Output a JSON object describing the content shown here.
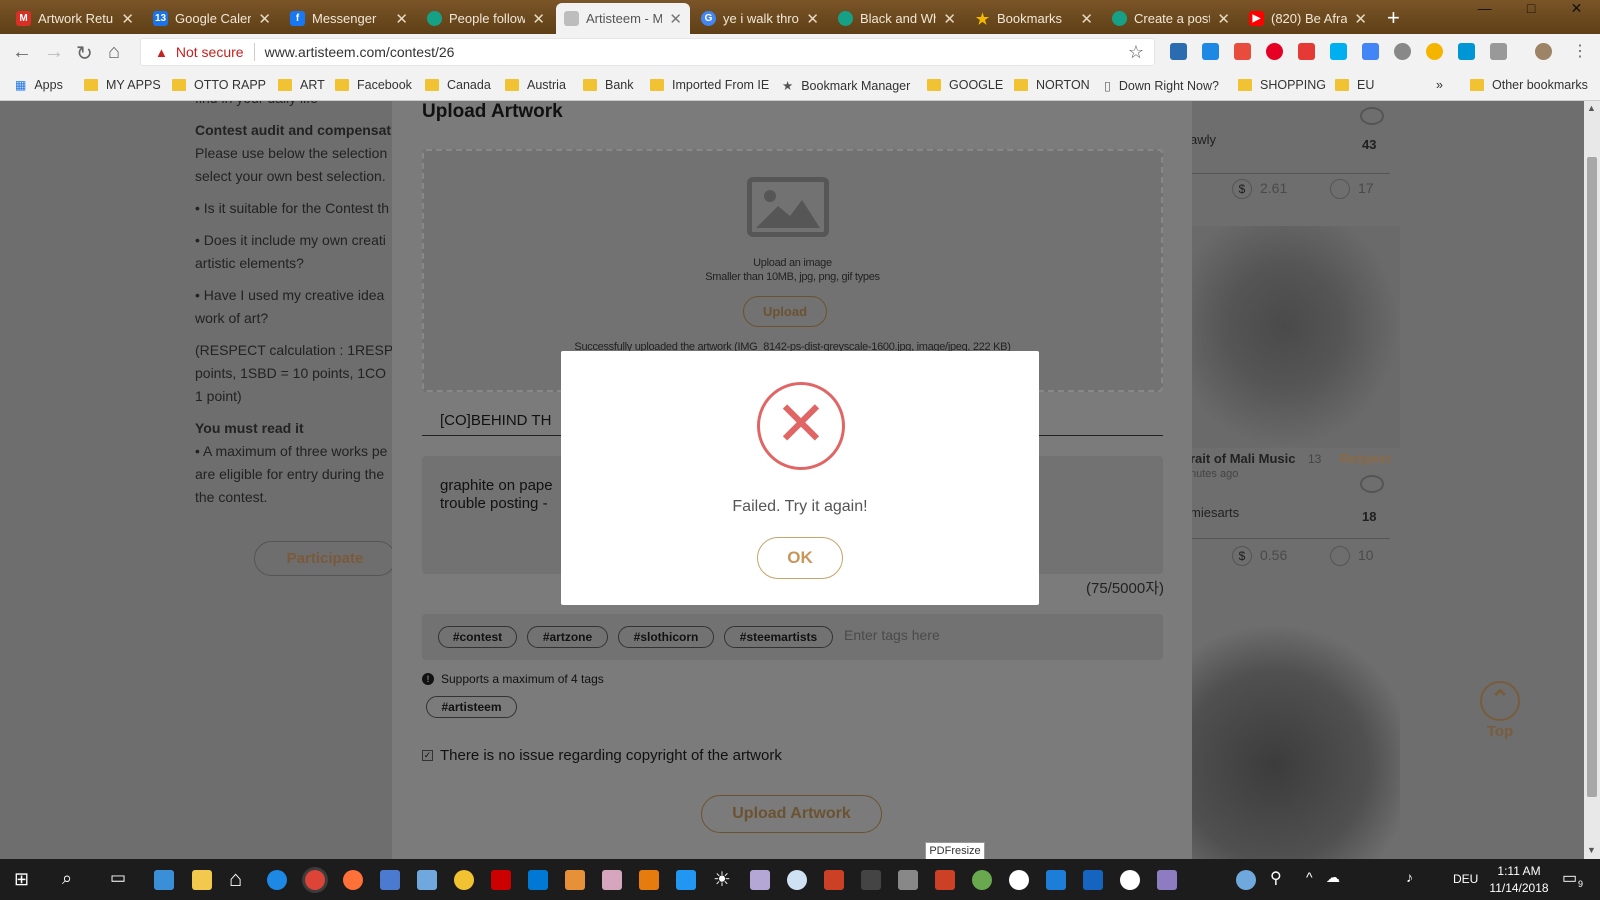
{
  "browser": {
    "tabs": [
      {
        "label": "Artwork Retur",
        "favicon": "gmail-icon",
        "color": "#d93025"
      },
      {
        "label": "Google Calen",
        "favicon": "google-calendar-icon",
        "color": "#1a73e8"
      },
      {
        "label": "Messenger",
        "favicon": "facebook-icon",
        "color": "#1877f2"
      },
      {
        "label": "People follow",
        "favicon": "steem-icon",
        "color": "#16a085"
      },
      {
        "label": "Artisteem - M",
        "favicon": "document-icon",
        "color": "#bdbdbd"
      },
      {
        "label": "ye i walk thro",
        "favicon": "google-icon",
        "color": "#4285f4"
      },
      {
        "label": "Black and Wh",
        "favicon": "steem-icon",
        "color": "#16a085"
      },
      {
        "label": "Bookmarks",
        "favicon": "star-icon",
        "color": "#f2b900"
      },
      {
        "label": "Create a post",
        "favicon": "steem-icon",
        "color": "#16a085"
      },
      {
        "label": "(820) Be Afrai",
        "favicon": "youtube-icon",
        "color": "#ff0000"
      }
    ],
    "url": "www.artisteem.com/contest/26",
    "security_label": "Not secure",
    "bookmarks": [
      {
        "label": "Apps",
        "type": "apps"
      },
      {
        "label": "MY APPS",
        "type": "folder"
      },
      {
        "label": "OTTO RAPP",
        "type": "folder"
      },
      {
        "label": "ART",
        "type": "folder"
      },
      {
        "label": "Facebook",
        "type": "folder"
      },
      {
        "label": "Canada",
        "type": "folder"
      },
      {
        "label": "Austria",
        "type": "folder"
      },
      {
        "label": "Bank",
        "type": "folder"
      },
      {
        "label": "Imported From IE",
        "type": "folder"
      },
      {
        "label": "Bookmark Manager",
        "type": "star"
      },
      {
        "label": "GOOGLE",
        "type": "folder"
      },
      {
        "label": "NORTON",
        "type": "folder"
      },
      {
        "label": "Down Right Now?",
        "type": "page"
      },
      {
        "label": "SHOPPING",
        "type": "folder"
      },
      {
        "label": "EU",
        "type": "folder"
      },
      {
        "label": "Other bookmarks",
        "type": "folder"
      }
    ]
  },
  "left_column": {
    "partial_top": "find in your daily life",
    "heading_audit": "Contest audit and compensat",
    "audit_text": "Please use below the selection select your own best selection.",
    "q1": "• Is it suitable for the Contest th",
    "q2": "• Does it include my own creati artistic elements?",
    "q3": "• Have I used my creative idea work of art?",
    "respect_calc": "(RESPECT calculation : 1RESP points, 1SBD = 10 points, 1CO 1 point)",
    "heading_read": "You must read it",
    "rule_text": "• A maximum of three works pe are eligible for entry during the the contest.",
    "participate_label": "Participate"
  },
  "right_column": {
    "top_author": "awly",
    "top_count": "43",
    "top_payout": "2.61",
    "top_comments": "17",
    "card_title": "rait of Mali Music",
    "card_num": "13",
    "card_respect": "Respect",
    "card_time": "nutes ago",
    "card_author": "miesarts",
    "card_count": "18",
    "card_payout": "0.56",
    "card_comments": "10",
    "top_button": "Top"
  },
  "upload_modal": {
    "title": "Upload Artwork",
    "dropzone_line1": "Upload an image",
    "dropzone_line2": "Smaller than 10MB, jpg, png, gif types",
    "upload_button": "Upload",
    "upload_status": "Successfully uploaded the artwork (IMG_8142-ps-dist-greyscale-1600.jpg, image/jpeg, 222 KB)",
    "title_field_value": "[CO]BEHIND TH",
    "description_line1": "graphite on pape",
    "description_line2": "trouble posting -",
    "char_counter": "(75/5000자)",
    "tags": [
      "#contest",
      "#artzone",
      "#slothicorn",
      "#steemartists"
    ],
    "tag_placeholder": "Enter tags here",
    "tag_limit_note": "Supports a maximum of 4 tags",
    "fixed_tag": "#artisteem",
    "copyright_label": "There is no issue regarding copyright of the artwork",
    "submit_label": "Upload Artwork"
  },
  "alert_dialog": {
    "message": "Failed. Try it again!",
    "ok_label": "OK",
    "icon": "error-x-icon",
    "accent_color": "#e06666"
  },
  "tooltip": "PDFresize",
  "taskbar": {
    "time": "1:11 AM",
    "date": "11/14/2018",
    "language": "DEU",
    "notification_count": "9"
  }
}
